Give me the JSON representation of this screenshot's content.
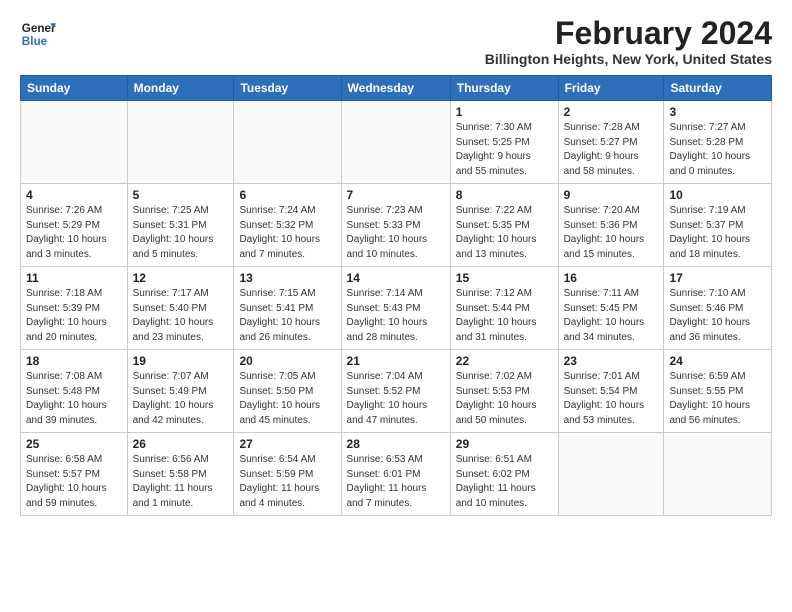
{
  "header": {
    "logo_line1": "General",
    "logo_line2": "Blue",
    "month": "February 2024",
    "location": "Billington Heights, New York, United States"
  },
  "weekdays": [
    "Sunday",
    "Monday",
    "Tuesday",
    "Wednesday",
    "Thursday",
    "Friday",
    "Saturday"
  ],
  "weeks": [
    [
      {
        "day": "",
        "info": ""
      },
      {
        "day": "",
        "info": ""
      },
      {
        "day": "",
        "info": ""
      },
      {
        "day": "",
        "info": ""
      },
      {
        "day": "1",
        "info": "Sunrise: 7:30 AM\nSunset: 5:25 PM\nDaylight: 9 hours\nand 55 minutes."
      },
      {
        "day": "2",
        "info": "Sunrise: 7:28 AM\nSunset: 5:27 PM\nDaylight: 9 hours\nand 58 minutes."
      },
      {
        "day": "3",
        "info": "Sunrise: 7:27 AM\nSunset: 5:28 PM\nDaylight: 10 hours\nand 0 minutes."
      }
    ],
    [
      {
        "day": "4",
        "info": "Sunrise: 7:26 AM\nSunset: 5:29 PM\nDaylight: 10 hours\nand 3 minutes."
      },
      {
        "day": "5",
        "info": "Sunrise: 7:25 AM\nSunset: 5:31 PM\nDaylight: 10 hours\nand 5 minutes."
      },
      {
        "day": "6",
        "info": "Sunrise: 7:24 AM\nSunset: 5:32 PM\nDaylight: 10 hours\nand 7 minutes."
      },
      {
        "day": "7",
        "info": "Sunrise: 7:23 AM\nSunset: 5:33 PM\nDaylight: 10 hours\nand 10 minutes."
      },
      {
        "day": "8",
        "info": "Sunrise: 7:22 AM\nSunset: 5:35 PM\nDaylight: 10 hours\nand 13 minutes."
      },
      {
        "day": "9",
        "info": "Sunrise: 7:20 AM\nSunset: 5:36 PM\nDaylight: 10 hours\nand 15 minutes."
      },
      {
        "day": "10",
        "info": "Sunrise: 7:19 AM\nSunset: 5:37 PM\nDaylight: 10 hours\nand 18 minutes."
      }
    ],
    [
      {
        "day": "11",
        "info": "Sunrise: 7:18 AM\nSunset: 5:39 PM\nDaylight: 10 hours\nand 20 minutes."
      },
      {
        "day": "12",
        "info": "Sunrise: 7:17 AM\nSunset: 5:40 PM\nDaylight: 10 hours\nand 23 minutes."
      },
      {
        "day": "13",
        "info": "Sunrise: 7:15 AM\nSunset: 5:41 PM\nDaylight: 10 hours\nand 26 minutes."
      },
      {
        "day": "14",
        "info": "Sunrise: 7:14 AM\nSunset: 5:43 PM\nDaylight: 10 hours\nand 28 minutes."
      },
      {
        "day": "15",
        "info": "Sunrise: 7:12 AM\nSunset: 5:44 PM\nDaylight: 10 hours\nand 31 minutes."
      },
      {
        "day": "16",
        "info": "Sunrise: 7:11 AM\nSunset: 5:45 PM\nDaylight: 10 hours\nand 34 minutes."
      },
      {
        "day": "17",
        "info": "Sunrise: 7:10 AM\nSunset: 5:46 PM\nDaylight: 10 hours\nand 36 minutes."
      }
    ],
    [
      {
        "day": "18",
        "info": "Sunrise: 7:08 AM\nSunset: 5:48 PM\nDaylight: 10 hours\nand 39 minutes."
      },
      {
        "day": "19",
        "info": "Sunrise: 7:07 AM\nSunset: 5:49 PM\nDaylight: 10 hours\nand 42 minutes."
      },
      {
        "day": "20",
        "info": "Sunrise: 7:05 AM\nSunset: 5:50 PM\nDaylight: 10 hours\nand 45 minutes."
      },
      {
        "day": "21",
        "info": "Sunrise: 7:04 AM\nSunset: 5:52 PM\nDaylight: 10 hours\nand 47 minutes."
      },
      {
        "day": "22",
        "info": "Sunrise: 7:02 AM\nSunset: 5:53 PM\nDaylight: 10 hours\nand 50 minutes."
      },
      {
        "day": "23",
        "info": "Sunrise: 7:01 AM\nSunset: 5:54 PM\nDaylight: 10 hours\nand 53 minutes."
      },
      {
        "day": "24",
        "info": "Sunrise: 6:59 AM\nSunset: 5:55 PM\nDaylight: 10 hours\nand 56 minutes."
      }
    ],
    [
      {
        "day": "25",
        "info": "Sunrise: 6:58 AM\nSunset: 5:57 PM\nDaylight: 10 hours\nand 59 minutes."
      },
      {
        "day": "26",
        "info": "Sunrise: 6:56 AM\nSunset: 5:58 PM\nDaylight: 11 hours\nand 1 minute."
      },
      {
        "day": "27",
        "info": "Sunrise: 6:54 AM\nSunset: 5:59 PM\nDaylight: 11 hours\nand 4 minutes."
      },
      {
        "day": "28",
        "info": "Sunrise: 6:53 AM\nSunset: 6:01 PM\nDaylight: 11 hours\nand 7 minutes."
      },
      {
        "day": "29",
        "info": "Sunrise: 6:51 AM\nSunset: 6:02 PM\nDaylight: 11 hours\nand 10 minutes."
      },
      {
        "day": "",
        "info": ""
      },
      {
        "day": "",
        "info": ""
      }
    ]
  ]
}
